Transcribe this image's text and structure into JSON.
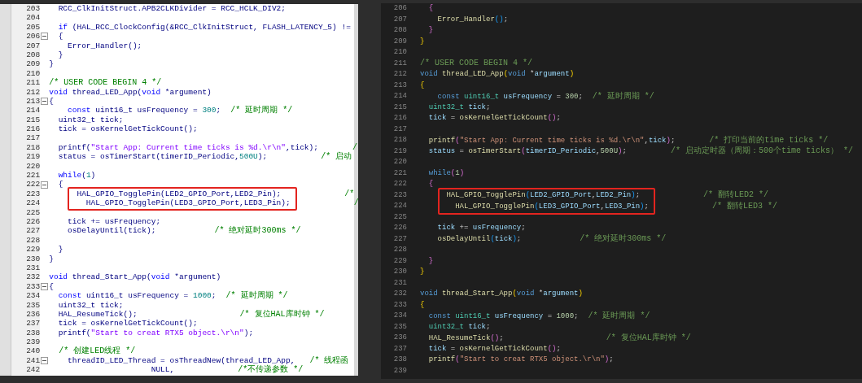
{
  "editors": [
    {
      "lines": [
        {
          "number": "203",
          "fold": false,
          "boxed": false,
          "segments": [
            {
              "kind": "plain",
              "text": "  RCC_ClkInitStruct.APB2CLKDivider = RCC_HCLK_DIV2;"
            }
          ]
        },
        {
          "number": "204",
          "fold": false,
          "boxed": false
        },
        {
          "number": "205",
          "fold": false,
          "boxed": false,
          "segments": [
            {
              "kind": "kw",
              "text": "  if"
            },
            {
              "kind": "plain",
              "text": " (HAL_RCC_ClockConfig(&RCC_ClkInitStruct, FLASH_LATENCY_5) !="
            }
          ]
        },
        {
          "number": "206",
          "fold": true,
          "boxed": false,
          "segments": [
            {
              "kind": "plain",
              "text": "  {"
            }
          ]
        },
        {
          "number": "207",
          "fold": false,
          "boxed": false,
          "segments": [
            {
              "kind": "plain",
              "text": "    Error_Handler();"
            }
          ]
        },
        {
          "number": "208",
          "fold": false,
          "boxed": false,
          "segments": [
            {
              "kind": "plain",
              "text": "  }"
            }
          ]
        },
        {
          "number": "209",
          "fold": false,
          "boxed": false,
          "segments": [
            {
              "kind": "plain",
              "text": "}"
            }
          ]
        },
        {
          "number": "210",
          "fold": false,
          "boxed": false
        },
        {
          "number": "211",
          "fold": false,
          "boxed": false,
          "segments": [
            {
              "kind": "com",
              "text": "/* USER CODE BEGIN 4 */"
            }
          ]
        },
        {
          "number": "212",
          "fold": false,
          "boxed": false,
          "segments": [
            {
              "kind": "kw",
              "text": "void"
            },
            {
              "kind": "plain",
              "text": " thread_LED_App("
            },
            {
              "kind": "kw",
              "text": "void"
            },
            {
              "kind": "plain",
              "text": " *argument)"
            }
          ]
        },
        {
          "number": "213",
          "fold": true,
          "boxed": false,
          "segments": [
            {
              "kind": "plain",
              "text": "{"
            }
          ]
        },
        {
          "number": "214",
          "fold": false,
          "boxed": false,
          "segments": [
            {
              "kind": "kw",
              "text": "    const"
            },
            {
              "kind": "plain",
              "text": " uint16_t usFrequency = "
            },
            {
              "kind": "num",
              "text": "300"
            },
            {
              "kind": "plain",
              "text": ";"
            },
            {
              "kind": "com",
              "text": "  /* 延时周期 */"
            }
          ]
        },
        {
          "number": "215",
          "fold": false,
          "boxed": false,
          "segments": [
            {
              "kind": "plain",
              "text": "  uint32_t tick;"
            }
          ]
        },
        {
          "number": "216",
          "fold": false,
          "boxed": false,
          "segments": [
            {
              "kind": "plain",
              "text": "  tick = osKernelGetTickCount();"
            }
          ]
        },
        {
          "number": "217",
          "fold": false,
          "boxed": false
        },
        {
          "number": "218",
          "fold": false,
          "boxed": false,
          "segments": [
            {
              "kind": "plain",
              "text": "  printf("
            },
            {
              "kind": "str",
              "text": "\"Start App: Current time ticks is %d.\\r\\n\""
            },
            {
              "kind": "plain",
              "text": ",tick);"
            },
            {
              "kind": "com",
              "text": "       /"
            }
          ]
        },
        {
          "number": "219",
          "fold": false,
          "boxed": false,
          "segments": [
            {
              "kind": "plain",
              "text": "  status = osTimerStart(timerID_Periodic,"
            },
            {
              "kind": "num",
              "text": "500U"
            },
            {
              "kind": "plain",
              "text": ");"
            },
            {
              "kind": "com",
              "text": "           /* 启动"
            }
          ]
        },
        {
          "number": "220",
          "fold": false,
          "boxed": false
        },
        {
          "number": "221",
          "fold": false,
          "boxed": false,
          "segments": [
            {
              "kind": "kw",
              "text": "  while"
            },
            {
              "kind": "plain",
              "text": "("
            },
            {
              "kind": "num",
              "text": "1"
            },
            {
              "kind": "plain",
              "text": ")"
            }
          ]
        },
        {
          "number": "222",
          "fold": true,
          "boxed": false,
          "segments": [
            {
              "kind": "plain",
              "text": "  {"
            }
          ]
        },
        {
          "number": "223",
          "fold": false,
          "boxed": true,
          "segments": [
            {
              "kind": "plain",
              "text": "      HAL_GPIO_TogglePin(LED2_GPIO_Port,LED2_Pin);"
            },
            {
              "kind": "com",
              "text": "             /*"
            }
          ]
        },
        {
          "number": "224",
          "fold": false,
          "boxed": true,
          "segments": [
            {
              "kind": "plain",
              "text": "        HAL_GPIO_TogglePin(LED3_GPIO_Port,LED3_Pin);"
            },
            {
              "kind": "com",
              "text": "             /"
            }
          ]
        },
        {
          "number": "225",
          "fold": false,
          "boxed": false
        },
        {
          "number": "226",
          "fold": false,
          "boxed": false,
          "segments": [
            {
              "kind": "plain",
              "text": "    tick += usFrequency;"
            }
          ]
        },
        {
          "number": "227",
          "fold": false,
          "boxed": false,
          "segments": [
            {
              "kind": "plain",
              "text": "    osDelayUntil(tick);"
            },
            {
              "kind": "com",
              "text": "            /* 绝对延时300ms */"
            }
          ]
        },
        {
          "number": "228",
          "fold": false,
          "boxed": false
        },
        {
          "number": "229",
          "fold": false,
          "boxed": false,
          "segments": [
            {
              "kind": "plain",
              "text": "  }"
            }
          ]
        },
        {
          "number": "230",
          "fold": false,
          "boxed": false,
          "segments": [
            {
              "kind": "plain",
              "text": "}"
            }
          ]
        },
        {
          "number": "231",
          "fold": false,
          "boxed": false
        },
        {
          "number": "232",
          "fold": false,
          "boxed": false,
          "segments": [
            {
              "kind": "kw",
              "text": "void"
            },
            {
              "kind": "plain",
              "text": " thread_Start_App("
            },
            {
              "kind": "kw",
              "text": "void"
            },
            {
              "kind": "plain",
              "text": " *argument)"
            }
          ]
        },
        {
          "number": "233",
          "fold": true,
          "boxed": false,
          "segments": [
            {
              "kind": "plain",
              "text": "{"
            }
          ]
        },
        {
          "number": "234",
          "fold": false,
          "boxed": false,
          "segments": [
            {
              "kind": "kw",
              "text": "  const"
            },
            {
              "kind": "plain",
              "text": " uint16_t usFrequency = "
            },
            {
              "kind": "num",
              "text": "1000"
            },
            {
              "kind": "plain",
              "text": ";"
            },
            {
              "kind": "com",
              "text": "  /* 延时周期 */"
            }
          ]
        },
        {
          "number": "235",
          "fold": false,
          "boxed": false,
          "segments": [
            {
              "kind": "plain",
              "text": "  uint32_t tick;"
            }
          ]
        },
        {
          "number": "236",
          "fold": false,
          "boxed": false,
          "segments": [
            {
              "kind": "plain",
              "text": "  HAL_ResumeTick();"
            },
            {
              "kind": "com",
              "text": "                     /* 复位HAL库时钟 */"
            }
          ]
        },
        {
          "number": "237",
          "fold": false,
          "boxed": false,
          "segments": [
            {
              "kind": "plain",
              "text": "  tick = osKernelGetTickCount();"
            }
          ]
        },
        {
          "number": "238",
          "fold": false,
          "boxed": false,
          "segments": [
            {
              "kind": "plain",
              "text": "  printf("
            },
            {
              "kind": "str",
              "text": "\"Start to creat RTX5 object.\\r\\n\""
            },
            {
              "kind": "plain",
              "text": ");"
            }
          ]
        },
        {
          "number": "239",
          "fold": false,
          "boxed": false
        },
        {
          "number": "240",
          "fold": false,
          "boxed": false,
          "segments": [
            {
              "kind": "com",
              "text": "  /* 创建LED线程 */"
            }
          ]
        },
        {
          "number": "241",
          "fold": true,
          "boxed": false,
          "segments": [
            {
              "kind": "plain",
              "text": "    threadID_LED_Thread = osThreadNew(thread_LED_App,"
            },
            {
              "kind": "com",
              "text": "   /* 线程函"
            }
          ]
        },
        {
          "number": "242",
          "fold": false,
          "boxed": false,
          "segments": [
            {
              "kind": "plain",
              "text": "                      NULL,"
            },
            {
              "kind": "com",
              "text": "             /*不传递参数 */"
            }
          ]
        }
      ]
    },
    {
      "lines": [
        {
          "number": "206",
          "fold": false,
          "boxed": false,
          "segments": [
            {
              "kind": "brace2",
              "text": "  {"
            }
          ]
        },
        {
          "number": "207",
          "fold": false,
          "boxed": false,
          "segments": [
            {
              "kind": "fn",
              "text": "    Error_Handler"
            },
            {
              "kind": "brace3",
              "text": "()"
            },
            {
              "kind": "plain",
              "text": ";"
            }
          ]
        },
        {
          "number": "208",
          "fold": false,
          "boxed": false,
          "segments": [
            {
              "kind": "brace2",
              "text": "  }"
            }
          ]
        },
        {
          "number": "209",
          "fold": false,
          "boxed": false,
          "segments": [
            {
              "kind": "brace1",
              "text": "}"
            }
          ]
        },
        {
          "number": "210",
          "fold": false,
          "boxed": false
        },
        {
          "number": "211",
          "fold": false,
          "boxed": false,
          "segments": [
            {
              "kind": "com",
              "text": "/* USER CODE BEGIN 4 */"
            }
          ]
        },
        {
          "number": "212",
          "fold": false,
          "boxed": false,
          "segments": [
            {
              "kind": "kw",
              "text": "void"
            },
            {
              "kind": "fn",
              "text": " thread_LED_App"
            },
            {
              "kind": "brace1",
              "text": "("
            },
            {
              "kind": "kw",
              "text": "void"
            },
            {
              "kind": "plain",
              "text": " *"
            },
            {
              "kind": "var",
              "text": "argument"
            },
            {
              "kind": "brace1",
              "text": ")"
            }
          ]
        },
        {
          "number": "213",
          "fold": false,
          "boxed": false,
          "segments": [
            {
              "kind": "brace1",
              "text": "{"
            }
          ]
        },
        {
          "number": "214",
          "fold": false,
          "boxed": false,
          "segments": [
            {
              "kind": "kw",
              "text": "    const"
            },
            {
              "kind": "type",
              "text": " uint16_t"
            },
            {
              "kind": "var",
              "text": " usFrequency"
            },
            {
              "kind": "plain",
              "text": " = "
            },
            {
              "kind": "num",
              "text": "300"
            },
            {
              "kind": "plain",
              "text": ";"
            },
            {
              "kind": "com",
              "text": "  /* 延时周期 */"
            }
          ]
        },
        {
          "number": "215",
          "fold": false,
          "boxed": false,
          "segments": [
            {
              "kind": "type",
              "text": "  uint32_t"
            },
            {
              "kind": "var",
              "text": " tick"
            },
            {
              "kind": "plain",
              "text": ";"
            }
          ]
        },
        {
          "number": "216",
          "fold": false,
          "boxed": false,
          "segments": [
            {
              "kind": "var",
              "text": "  tick"
            },
            {
              "kind": "plain",
              "text": " = "
            },
            {
              "kind": "fn",
              "text": "osKernelGetTickCount"
            },
            {
              "kind": "brace2",
              "text": "()"
            },
            {
              "kind": "plain",
              "text": ";"
            }
          ]
        },
        {
          "number": "217",
          "fold": false,
          "boxed": false
        },
        {
          "number": "218",
          "fold": false,
          "boxed": false,
          "segments": [
            {
              "kind": "fn",
              "text": "  printf"
            },
            {
              "kind": "brace2",
              "text": "("
            },
            {
              "kind": "str",
              "text": "\"Start App: Current time ticks is %d.\\r\\n\""
            },
            {
              "kind": "plain",
              "text": ","
            },
            {
              "kind": "var",
              "text": "tick"
            },
            {
              "kind": "brace2",
              "text": ")"
            },
            {
              "kind": "plain",
              "text": ";"
            },
            {
              "kind": "com",
              "text": "       /* 打印当前的time ticks */"
            }
          ]
        },
        {
          "number": "219",
          "fold": false,
          "boxed": false,
          "segments": [
            {
              "kind": "var",
              "text": "  status"
            },
            {
              "kind": "plain",
              "text": " = "
            },
            {
              "kind": "fn",
              "text": "osTimerStart"
            },
            {
              "kind": "brace2",
              "text": "("
            },
            {
              "kind": "var",
              "text": "timerID_Periodic"
            },
            {
              "kind": "plain",
              "text": ","
            },
            {
              "kind": "num",
              "text": "500U"
            },
            {
              "kind": "brace2",
              "text": ")"
            },
            {
              "kind": "plain",
              "text": ";"
            },
            {
              "kind": "com",
              "text": "         /* 启动定时器（周期：500个time ticks） */"
            }
          ]
        },
        {
          "number": "220",
          "fold": false,
          "boxed": false
        },
        {
          "number": "221",
          "fold": false,
          "boxed": false,
          "segments": [
            {
              "kind": "kw",
              "text": "  while"
            },
            {
              "kind": "brace2",
              "text": "("
            },
            {
              "kind": "num",
              "text": "1"
            },
            {
              "kind": "brace2",
              "text": ")"
            }
          ]
        },
        {
          "number": "222",
          "fold": false,
          "boxed": false,
          "segments": [
            {
              "kind": "brace2",
              "text": "  {"
            }
          ]
        },
        {
          "number": "223",
          "fold": false,
          "boxed": true,
          "segments": [
            {
              "kind": "fn",
              "text": "      HAL_GPIO_TogglePin"
            },
            {
              "kind": "brace3",
              "text": "("
            },
            {
              "kind": "var",
              "text": "LED2_GPIO_Port"
            },
            {
              "kind": "plain",
              "text": ","
            },
            {
              "kind": "var",
              "text": "LED2_Pin"
            },
            {
              "kind": "brace3",
              "text": ")"
            },
            {
              "kind": "plain",
              "text": ";"
            },
            {
              "kind": "com",
              "text": "             /* 翻转LED2 */"
            }
          ]
        },
        {
          "number": "224",
          "fold": false,
          "boxed": true,
          "segments": [
            {
              "kind": "fn",
              "text": "        HAL_GPIO_TogglePin"
            },
            {
              "kind": "brace3",
              "text": "("
            },
            {
              "kind": "var",
              "text": "LED3_GPIO_Port"
            },
            {
              "kind": "plain",
              "text": ","
            },
            {
              "kind": "var",
              "text": "LED3_Pin"
            },
            {
              "kind": "brace3",
              "text": ")"
            },
            {
              "kind": "plain",
              "text": ";"
            },
            {
              "kind": "com",
              "text": "             /* 翻转LED3 */"
            }
          ]
        },
        {
          "number": "225",
          "fold": false,
          "boxed": false
        },
        {
          "number": "226",
          "fold": false,
          "boxed": false,
          "segments": [
            {
              "kind": "var",
              "text": "    tick"
            },
            {
              "kind": "plain",
              "text": " += "
            },
            {
              "kind": "var",
              "text": "usFrequency"
            },
            {
              "kind": "plain",
              "text": ";"
            }
          ]
        },
        {
          "number": "227",
          "fold": false,
          "boxed": false,
          "segments": [
            {
              "kind": "fn",
              "text": "    osDelayUntil"
            },
            {
              "kind": "brace3",
              "text": "("
            },
            {
              "kind": "var",
              "text": "tick"
            },
            {
              "kind": "brace3",
              "text": ")"
            },
            {
              "kind": "plain",
              "text": ";"
            },
            {
              "kind": "com",
              "text": "            /* 绝对延时300ms */"
            }
          ]
        },
        {
          "number": "228",
          "fold": false,
          "boxed": false
        },
        {
          "number": "229",
          "fold": false,
          "boxed": false,
          "segments": [
            {
              "kind": "brace2",
              "text": "  }"
            }
          ]
        },
        {
          "number": "230",
          "fold": false,
          "boxed": false,
          "segments": [
            {
              "kind": "brace1",
              "text": "}"
            }
          ]
        },
        {
          "number": "231",
          "fold": false,
          "boxed": false
        },
        {
          "number": "232",
          "fold": false,
          "boxed": false,
          "segments": [
            {
              "kind": "kw",
              "text": "void"
            },
            {
              "kind": "fn",
              "text": " thread_Start_App"
            },
            {
              "kind": "brace1",
              "text": "("
            },
            {
              "kind": "kw",
              "text": "void"
            },
            {
              "kind": "plain",
              "text": " *"
            },
            {
              "kind": "var",
              "text": "argument"
            },
            {
              "kind": "brace1",
              "text": ")"
            }
          ]
        },
        {
          "number": "233",
          "fold": false,
          "boxed": false,
          "segments": [
            {
              "kind": "brace1",
              "text": "{"
            }
          ]
        },
        {
          "number": "234",
          "fold": false,
          "boxed": false,
          "segments": [
            {
              "kind": "kw",
              "text": "  const"
            },
            {
              "kind": "type",
              "text": " uint16_t"
            },
            {
              "kind": "var",
              "text": " usFrequency"
            },
            {
              "kind": "plain",
              "text": " = "
            },
            {
              "kind": "num",
              "text": "1000"
            },
            {
              "kind": "plain",
              "text": ";"
            },
            {
              "kind": "com",
              "text": "  /* 延时周期 */"
            }
          ]
        },
        {
          "number": "235",
          "fold": false,
          "boxed": false,
          "segments": [
            {
              "kind": "type",
              "text": "  uint32_t"
            },
            {
              "kind": "var",
              "text": " tick"
            },
            {
              "kind": "plain",
              "text": ";"
            }
          ]
        },
        {
          "number": "236",
          "fold": false,
          "boxed": false,
          "segments": [
            {
              "kind": "fn",
              "text": "  HAL_ResumeTick"
            },
            {
              "kind": "brace2",
              "text": "()"
            },
            {
              "kind": "plain",
              "text": ";"
            },
            {
              "kind": "com",
              "text": "                     /* 复位HAL库时钟 */"
            }
          ]
        },
        {
          "number": "237",
          "fold": false,
          "boxed": false,
          "segments": [
            {
              "kind": "var",
              "text": "  tick"
            },
            {
              "kind": "plain",
              "text": " = "
            },
            {
              "kind": "fn",
              "text": "osKernelGetTickCount"
            },
            {
              "kind": "brace2",
              "text": "()"
            },
            {
              "kind": "plain",
              "text": ";"
            }
          ]
        },
        {
          "number": "238",
          "fold": false,
          "boxed": false,
          "segments": [
            {
              "kind": "fn",
              "text": "  printf"
            },
            {
              "kind": "brace2",
              "text": "("
            },
            {
              "kind": "str",
              "text": "\"Start to creat RTX5 object.\\r\\n\""
            },
            {
              "kind": "brace2",
              "text": ")"
            },
            {
              "kind": "plain",
              "text": ";"
            }
          ]
        },
        {
          "number": "239",
          "fold": false,
          "boxed": false
        }
      ]
    }
  ]
}
